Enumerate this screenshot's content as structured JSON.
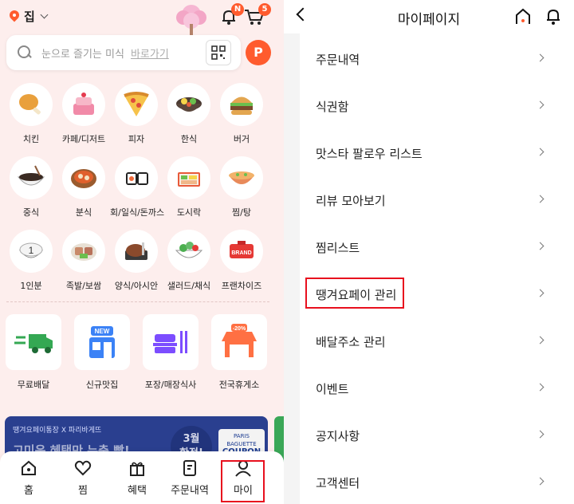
{
  "left": {
    "location": "집",
    "notification_badge": "N",
    "cart_badge": "5",
    "search": {
      "placeholder": "눈으로 즐기는 미식",
      "link": "바로가기"
    },
    "point_label": "P",
    "categories": [
      {
        "label": "치킨",
        "icon": "chicken-icon"
      },
      {
        "label": "카페/디저트",
        "icon": "cake-icon"
      },
      {
        "label": "피자",
        "icon": "pizza-icon"
      },
      {
        "label": "한식",
        "icon": "bibimbap-icon"
      },
      {
        "label": "버거",
        "icon": "burger-icon"
      },
      {
        "label": "중식",
        "icon": "noodle-icon"
      },
      {
        "label": "분식",
        "icon": "tteokbokki-icon"
      },
      {
        "label": "회/일식/돈까스",
        "icon": "sushi-icon"
      },
      {
        "label": "도시락",
        "icon": "lunchbox-icon"
      },
      {
        "label": "찜/탕",
        "icon": "stew-icon"
      },
      {
        "label": "1인분",
        "icon": "single-meal-icon"
      },
      {
        "label": "족발/보쌈",
        "icon": "pork-icon"
      },
      {
        "label": "양식/아시안",
        "icon": "steak-icon"
      },
      {
        "label": "샐러드/채식",
        "icon": "salad-icon"
      },
      {
        "label": "프랜차이즈",
        "icon": "brand-icon"
      }
    ],
    "brand_text": "BRAND",
    "single_text": "1",
    "features": [
      {
        "label": "무료배달",
        "icon": "free-delivery-icon"
      },
      {
        "label": "신규맛집",
        "icon": "new-store-icon"
      },
      {
        "label": "포장/매장식사",
        "icon": "takeout-icon"
      },
      {
        "label": "전국휴게소",
        "icon": "rest-area-icon"
      }
    ],
    "new_text": "NEW",
    "discount_text": "-20%",
    "banner": {
      "line1": "땡겨요페이통장 X 파리바게뜨",
      "line2": "고미운 혜택만 누충 빵!",
      "month": "3월",
      "month_sub": "한정!",
      "coupon_brand": "PARIS BAGUETTE",
      "coupon_text": "COUPON"
    },
    "tabs": [
      {
        "label": "홈",
        "icon": "home-icon"
      },
      {
        "label": "찜",
        "icon": "heart-icon"
      },
      {
        "label": "혜택",
        "icon": "gift-icon"
      },
      {
        "label": "주문내역",
        "icon": "receipt-icon"
      },
      {
        "label": "마이",
        "icon": "person-icon"
      }
    ]
  },
  "right": {
    "title": "마이페이지",
    "menu": [
      "주문내역",
      "식권함",
      "맛스타 팔로우 리스트",
      "리뷰 모아보기",
      "찜리스트",
      "땡겨요페이 관리",
      "배달주소 관리",
      "이벤트",
      "공지사항",
      "고객센터"
    ]
  },
  "colors": {
    "accent": "#ff5b2e",
    "highlight": "#e8101e",
    "left_bg": "#fdeeed"
  }
}
